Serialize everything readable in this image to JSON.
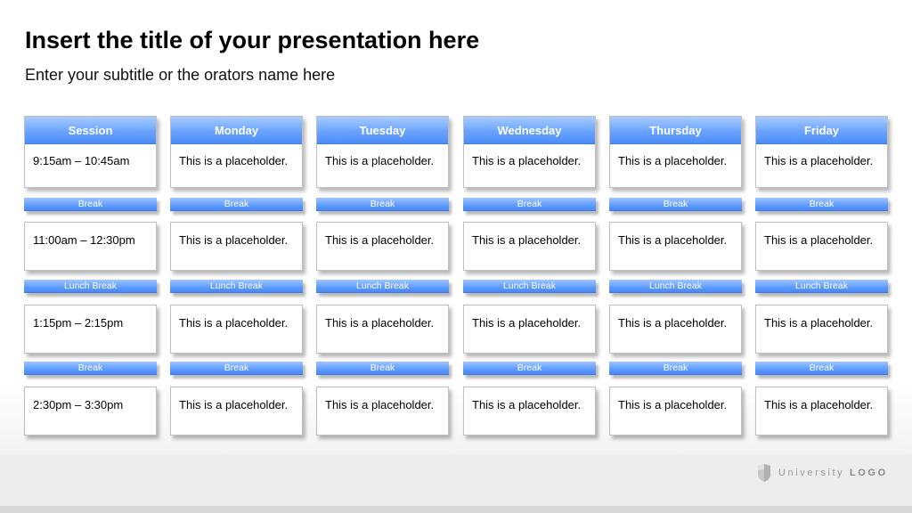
{
  "title": "Insert the title of your presentation here",
  "subtitle": "Enter your subtitle or the orators name here",
  "columns": [
    "Session",
    "Monday",
    "Tuesday",
    "Wednesday",
    "Thursday",
    "Friday"
  ],
  "sessions": [
    {
      "time": "9:15am – 10:45am",
      "cells": [
        "This is a placeholder.",
        "This is a placeholder.",
        "This is a placeholder.",
        "This is a placeholder.",
        "This is a placeholder."
      ]
    },
    {
      "time": "11:00am – 12:30pm",
      "cells": [
        "This is a placeholder.",
        "This is a placeholder.",
        "This is a placeholder.",
        "This is a placeholder.",
        "This is a placeholder."
      ]
    },
    {
      "time": "1:15pm – 2:15pm",
      "cells": [
        "This is a placeholder.",
        "This is a placeholder.",
        "This is a placeholder.",
        "This is a placeholder.",
        "This is a placeholder."
      ]
    },
    {
      "time": "2:30pm – 3:30pm",
      "cells": [
        "This is a placeholder.",
        "This is a placeholder.",
        "This is a placeholder.",
        "This is a placeholder.",
        "This is a placeholder."
      ]
    }
  ],
  "breaks": [
    [
      "Break",
      "Break",
      "Break",
      "Break",
      "Break",
      "Break"
    ],
    [
      "Lunch Break",
      "Lunch Break",
      "Lunch Break",
      "Lunch Break",
      "Lunch Break",
      "Lunch Break"
    ],
    [
      "Break",
      "Break",
      "Break",
      "Break",
      "Break",
      "Break"
    ]
  ],
  "logo": {
    "text": "University",
    "bold": "LOGO",
    "icon": "shield-icon"
  },
  "colors": {
    "header_blue": "#5b9aff",
    "border": "#bfbfbf",
    "footer": "#ededed"
  }
}
